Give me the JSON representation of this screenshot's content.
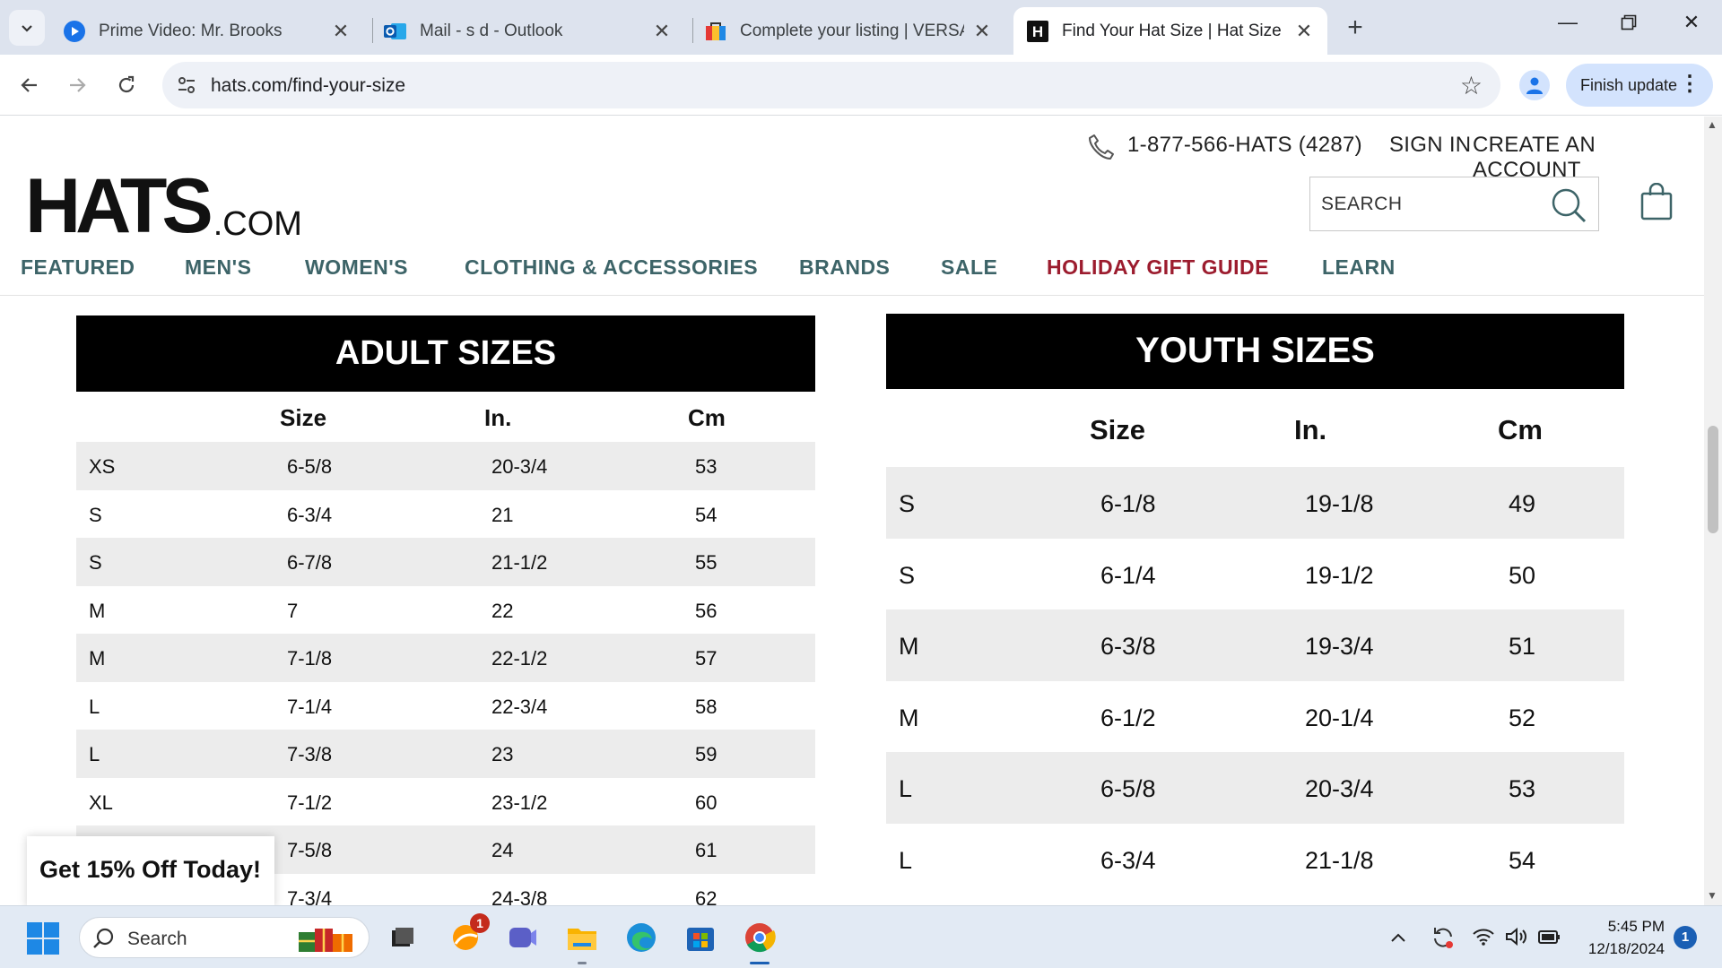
{
  "browser": {
    "tabs": [
      {
        "title": "Prime Video: Mr. Brooks",
        "icon": "prime-video-icon",
        "active": false
      },
      {
        "title": "Mail - s d - Outlook",
        "icon": "outlook-icon",
        "active": false
      },
      {
        "title": "Complete your listing | VERSACI",
        "icon": "listing-icon",
        "active": false
      },
      {
        "title": "Find Your Hat Size | Hat Size Ch",
        "icon": "hats-favicon-icon",
        "active": true
      }
    ],
    "url": "hats.com/find-your-size",
    "finish_update_label": "Finish update"
  },
  "site": {
    "phone": "1-877-566-HATS (4287)",
    "sign_in": "SIGN IN",
    "create_account": "CREATE AN ACCOUNT",
    "logo_main": "HATS",
    "logo_suffix": ".COM",
    "search_placeholder": "SEARCH",
    "nav": [
      "FEATURED",
      "MEN'S",
      "WOMEN'S",
      "CLOTHING & ACCESSORIES",
      "BRANDS",
      "SALE",
      "HOLIDAY GIFT GUIDE",
      "LEARN"
    ],
    "nav_highlight_color": "#9c1c2e",
    "nav_color": "#3d6468"
  },
  "adult": {
    "title": "ADULT SIZES",
    "columns": [
      "",
      "Size",
      "In.",
      "Cm"
    ],
    "rows": [
      [
        "XS",
        "6-5/8",
        "20-3/4",
        "53"
      ],
      [
        "S",
        "6-3/4",
        "21",
        "54"
      ],
      [
        "S",
        "6-7/8",
        "21-1/2",
        "55"
      ],
      [
        "M",
        "7",
        "22",
        "56"
      ],
      [
        "M",
        "7-1/8",
        "22-1/2",
        "57"
      ],
      [
        "L",
        "7-1/4",
        "22-3/4",
        "58"
      ],
      [
        "L",
        "7-3/8",
        "23",
        "59"
      ],
      [
        "XL",
        "7-1/2",
        "23-1/2",
        "60"
      ],
      [
        "",
        "7-5/8",
        "24",
        "61"
      ],
      [
        "",
        "7-3/4",
        "24-3/8",
        "62"
      ]
    ]
  },
  "youth": {
    "title": "YOUTH SIZES",
    "columns": [
      "",
      "Size",
      "In.",
      "Cm"
    ],
    "rows": [
      [
        "S",
        "6-1/8",
        "19-1/8",
        "49"
      ],
      [
        "S",
        "6-1/4",
        "19-1/2",
        "50"
      ],
      [
        "M",
        "6-3/8",
        "19-3/4",
        "51"
      ],
      [
        "M",
        "6-1/2",
        "20-1/4",
        "52"
      ],
      [
        "L",
        "6-5/8",
        "20-3/4",
        "53"
      ],
      [
        "L",
        "6-3/4",
        "21-1/8",
        "54"
      ]
    ]
  },
  "promo": "Get 15% Off Today!",
  "taskbar": {
    "search_label": "Search",
    "badge_count": "1",
    "time": "5:45 PM",
    "date": "12/18/2024",
    "notification_count": "1"
  }
}
